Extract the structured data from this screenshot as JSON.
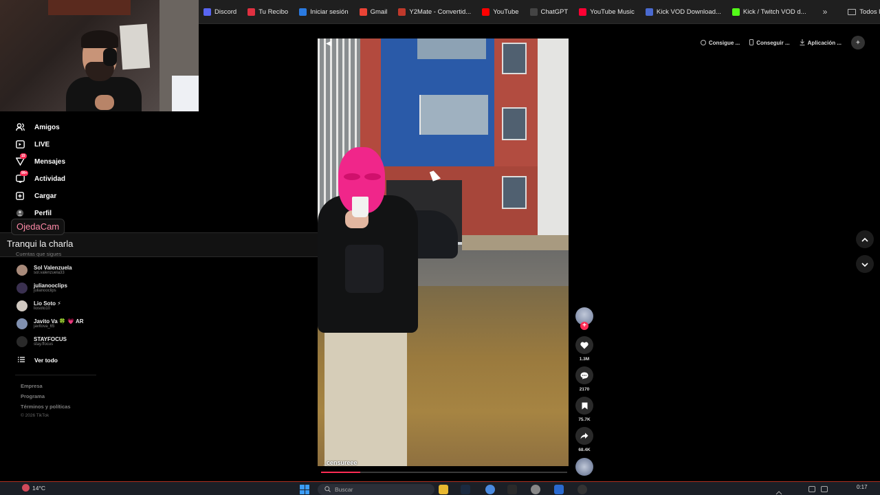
{
  "bookmarks": {
    "items": [
      {
        "label": "Discord",
        "icon": "discord-icon",
        "color": "#5865f2"
      },
      {
        "label": "Tu Recibo",
        "icon": "bookmark-icon",
        "color": "#e03040"
      },
      {
        "label": "Iniciar sesión",
        "icon": "login-icon",
        "color": "#2a7ae0"
      },
      {
        "label": "Gmail",
        "icon": "gmail-icon",
        "color": "#ea4335"
      },
      {
        "label": "Y2Mate - Convertid...",
        "icon": "y2mate-icon",
        "color": "#c0392b"
      },
      {
        "label": "YouTube",
        "icon": "youtube-icon",
        "color": "#ff0000"
      },
      {
        "label": "ChatGPT",
        "icon": "chatgpt-icon",
        "color": "#444444"
      },
      {
        "label": "YouTube Music",
        "icon": "youtube-music-icon",
        "color": "#ff0033"
      },
      {
        "label": "Kick VOD Download...",
        "icon": "kick-vod-icon",
        "color": "#4a6ad0"
      },
      {
        "label": "Kick / Twitch VOD d...",
        "icon": "kick-icon",
        "color": "#53fc18"
      }
    ],
    "more_symbol": "»",
    "folder_label": "Todos los marcadores"
  },
  "sidebar": {
    "nav": [
      {
        "label": "Amigos",
        "icon": "friends-icon"
      },
      {
        "label": "LIVE",
        "icon": "live-icon"
      },
      {
        "label": "Mensajes",
        "icon": "messages-icon",
        "badge": "15"
      },
      {
        "label": "Actividad",
        "icon": "activity-icon",
        "badge": "99+"
      },
      {
        "label": "Cargar",
        "icon": "upload-icon"
      },
      {
        "label": "Perfil",
        "icon": "profile-icon"
      }
    ],
    "overlay_name": "OjedaCam",
    "overlay_caption": "Tranqui la charla",
    "following_heading": "Cuentas que sigues",
    "accounts": [
      {
        "name": "Sol Valenzuela",
        "handle": "sol.valenzuela33",
        "color": "#a88a7a"
      },
      {
        "name": "julianooclips",
        "handle": "julianooclips",
        "color": "#3a3050"
      },
      {
        "name": "Lio Soto ⚡",
        "handle": "liosoto10",
        "color": "#d0c8c0"
      },
      {
        "name": "Javito Va 🍀 💗 AR",
        "handle": "javitova_65",
        "color": "#8090b0"
      },
      {
        "name": "STAYFOCUS",
        "handle": "stay.ffocus",
        "color": "#2a2a2a"
      }
    ],
    "see_all": "Ver todo",
    "footer_links": [
      "Empresa",
      "Programa",
      "Términos y políticas"
    ],
    "copyright": "© 2026 TikTok"
  },
  "top_actions": [
    {
      "label": "Consigue ...",
      "icon": "coin-icon"
    },
    {
      "label": "Conseguir ...",
      "icon": "phone-icon"
    },
    {
      "label": "Aplicación ...",
      "icon": "download-icon"
    }
  ],
  "video": {
    "username": "_censureee",
    "progress": 0.16
  },
  "actions": {
    "likes": "1.3M",
    "comments": "2170",
    "saves": "75.7K",
    "shares": "68.4K"
  },
  "taskbar": {
    "weather": "14°C",
    "search_placeholder": "Buscar",
    "time": "0:17"
  }
}
